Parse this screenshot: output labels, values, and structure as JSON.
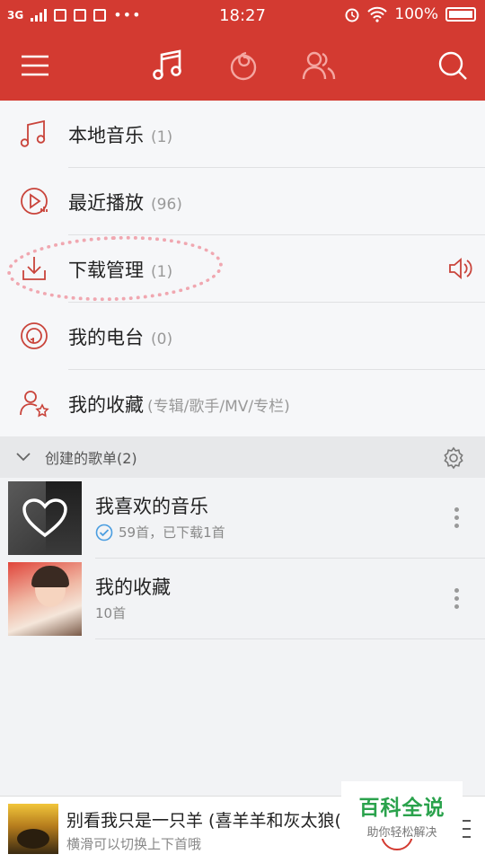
{
  "status_bar": {
    "network": "3G",
    "time": "18:27",
    "battery": "100%"
  },
  "app_bar": {
    "icons": [
      "menu-icon",
      "music-note-icon",
      "netease-logo-icon",
      "friends-icon",
      "search-icon"
    ]
  },
  "menu": {
    "items": [
      {
        "label": "本地音乐",
        "count": "(1)"
      },
      {
        "label": "最近播放",
        "count": "(96)"
      },
      {
        "label": "下载管理",
        "count": "(1)"
      },
      {
        "label": "我的电台",
        "count": "(0)"
      },
      {
        "label": "我的收藏",
        "count": "(专辑/歌手/MV/专栏)"
      }
    ]
  },
  "section": {
    "title": "创建的歌单(2)"
  },
  "playlists": [
    {
      "name": "我喜欢的音乐",
      "sub": "59首，已下载1首"
    },
    {
      "name": "我的收藏",
      "sub": "10首"
    }
  ],
  "player": {
    "song": "别看我只是一只羊 (喜羊羊和灰太狼(主题曲)",
    "hint": "横滑可以切换上下首哦"
  },
  "watermark": {
    "title": "百科全说",
    "subtitle": "助你轻松解决"
  },
  "colors": {
    "accent": "#d33a31",
    "highlight": "#f0a7b0",
    "watermark_green": "#2aa24c"
  }
}
